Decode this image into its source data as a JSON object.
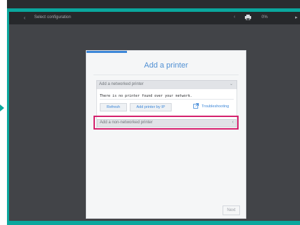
{
  "topbar": {
    "title": "Select configuration",
    "left_chevron": "‹",
    "mid_icon": "‹",
    "progress": "0%",
    "edge_icon": "▸"
  },
  "dialog": {
    "title": "Add a printer",
    "networked_section": {
      "label": "Add a networked printer",
      "chevron": "⌄",
      "status_message": "There is no printer found over your network.",
      "refresh_label": "Refresh",
      "add_by_ip_label": "Add printer by IP",
      "troubleshooting_label": "Troubleshooting"
    },
    "non_networked_section": {
      "label": "Add a non-networked printer",
      "chevron": "‹"
    },
    "next_label": "Next"
  },
  "colors": {
    "frame_teal": "#0aa79d",
    "accent_blue": "#3b86d8",
    "highlight_magenta": "#d41f6c"
  }
}
